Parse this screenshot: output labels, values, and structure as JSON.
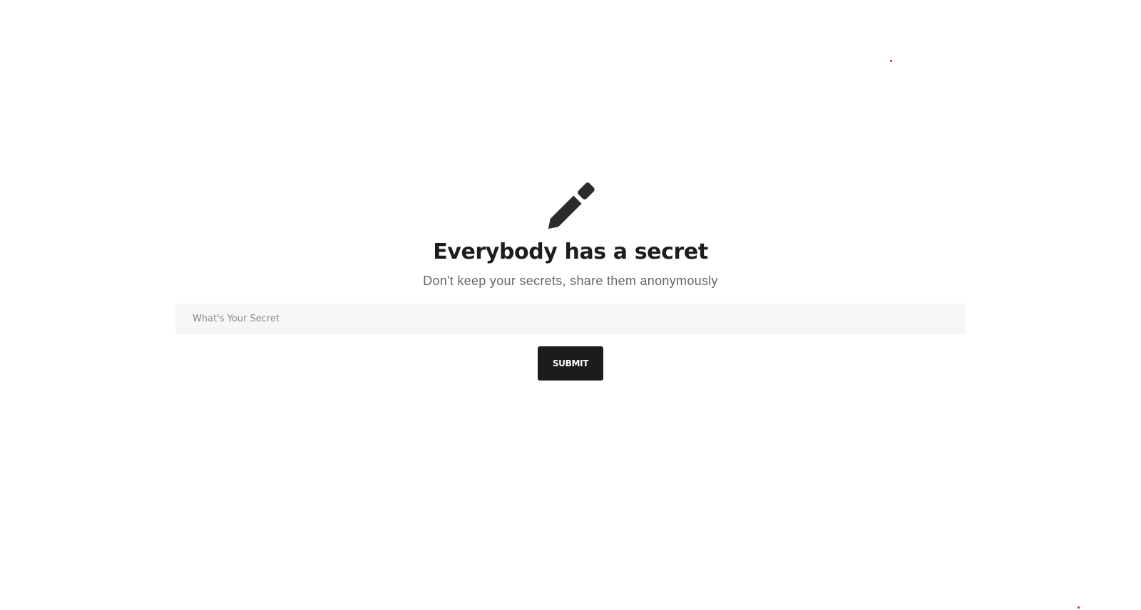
{
  "hero": {
    "icon": "pencil-icon",
    "title": "Everybody has a secret",
    "subtitle": "Don't keep your secrets, share them anonymously"
  },
  "form": {
    "secret_placeholder": "What's Your Secret",
    "submit_label": "SUBMIT"
  },
  "colors": {
    "background": "#ffffff",
    "icon": "#2b2b2b",
    "title": "#1d1d1d",
    "subtitle": "#666666",
    "input_background": "#f6f6f8",
    "button_background": "#1c1c1c",
    "accent_dot": "#d9172f"
  }
}
